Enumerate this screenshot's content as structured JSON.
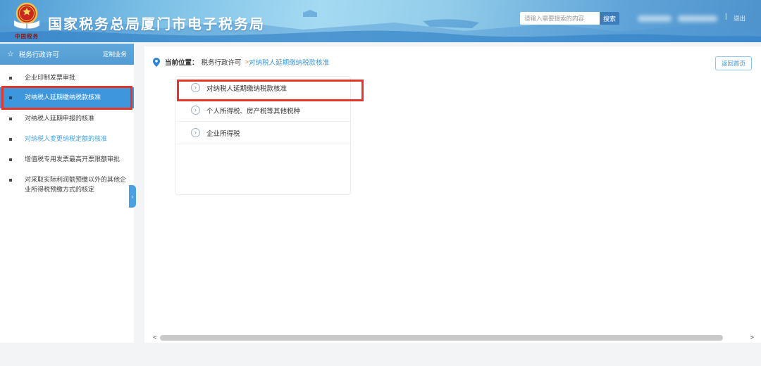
{
  "header": {
    "title": "国家税务总局厦门市电子税务局",
    "logo_caption": "中国税务",
    "search_placeholder": "请输入需要搜索的内容",
    "search_button_label": "搜索",
    "divider": "|",
    "logout_label": "退出"
  },
  "sidebar": {
    "title": "税务行政许可",
    "action_label": "定制业务",
    "items": [
      {
        "label": "企业印制发票审批"
      },
      {
        "label": "对纳税人延期缴纳税款核准",
        "selected": true,
        "highlighted": true
      },
      {
        "label": "对纳税人延期申报的核准"
      },
      {
        "label": "对纳税人变更纳税定额的核准",
        "link_style": true
      },
      {
        "label": "增值税专用发票最高开票限额审批"
      },
      {
        "label": "对采取实际利润额预缴以外的其他企业所得税预缴方式的核定"
      }
    ]
  },
  "main": {
    "breadcrumb": {
      "label": "当前位置：",
      "parent": "税务行政许可",
      "separator": ">",
      "current": "对纳税人延期缴纳税款核准"
    },
    "back_home_label": "返回首页",
    "menu_items": [
      {
        "label": "对纳税人延期缴纳税款核准",
        "highlighted": true
      },
      {
        "label": "个人所得税、房产税等其他税种"
      },
      {
        "label": "企业所得税"
      }
    ]
  },
  "icons": {
    "sidebar_star": "☆",
    "menu_item_chevron": "›",
    "collapse_handle": "‹",
    "scroll_left": "<",
    "scroll_right": ">"
  },
  "colors": {
    "accent_blue": "#3e97dd",
    "sidebar_header_blue": "#59a2d7",
    "annotation_red": "#e4372b",
    "header_sky_blue": "#93cdea",
    "search_button_blue": "#3d7cba"
  }
}
